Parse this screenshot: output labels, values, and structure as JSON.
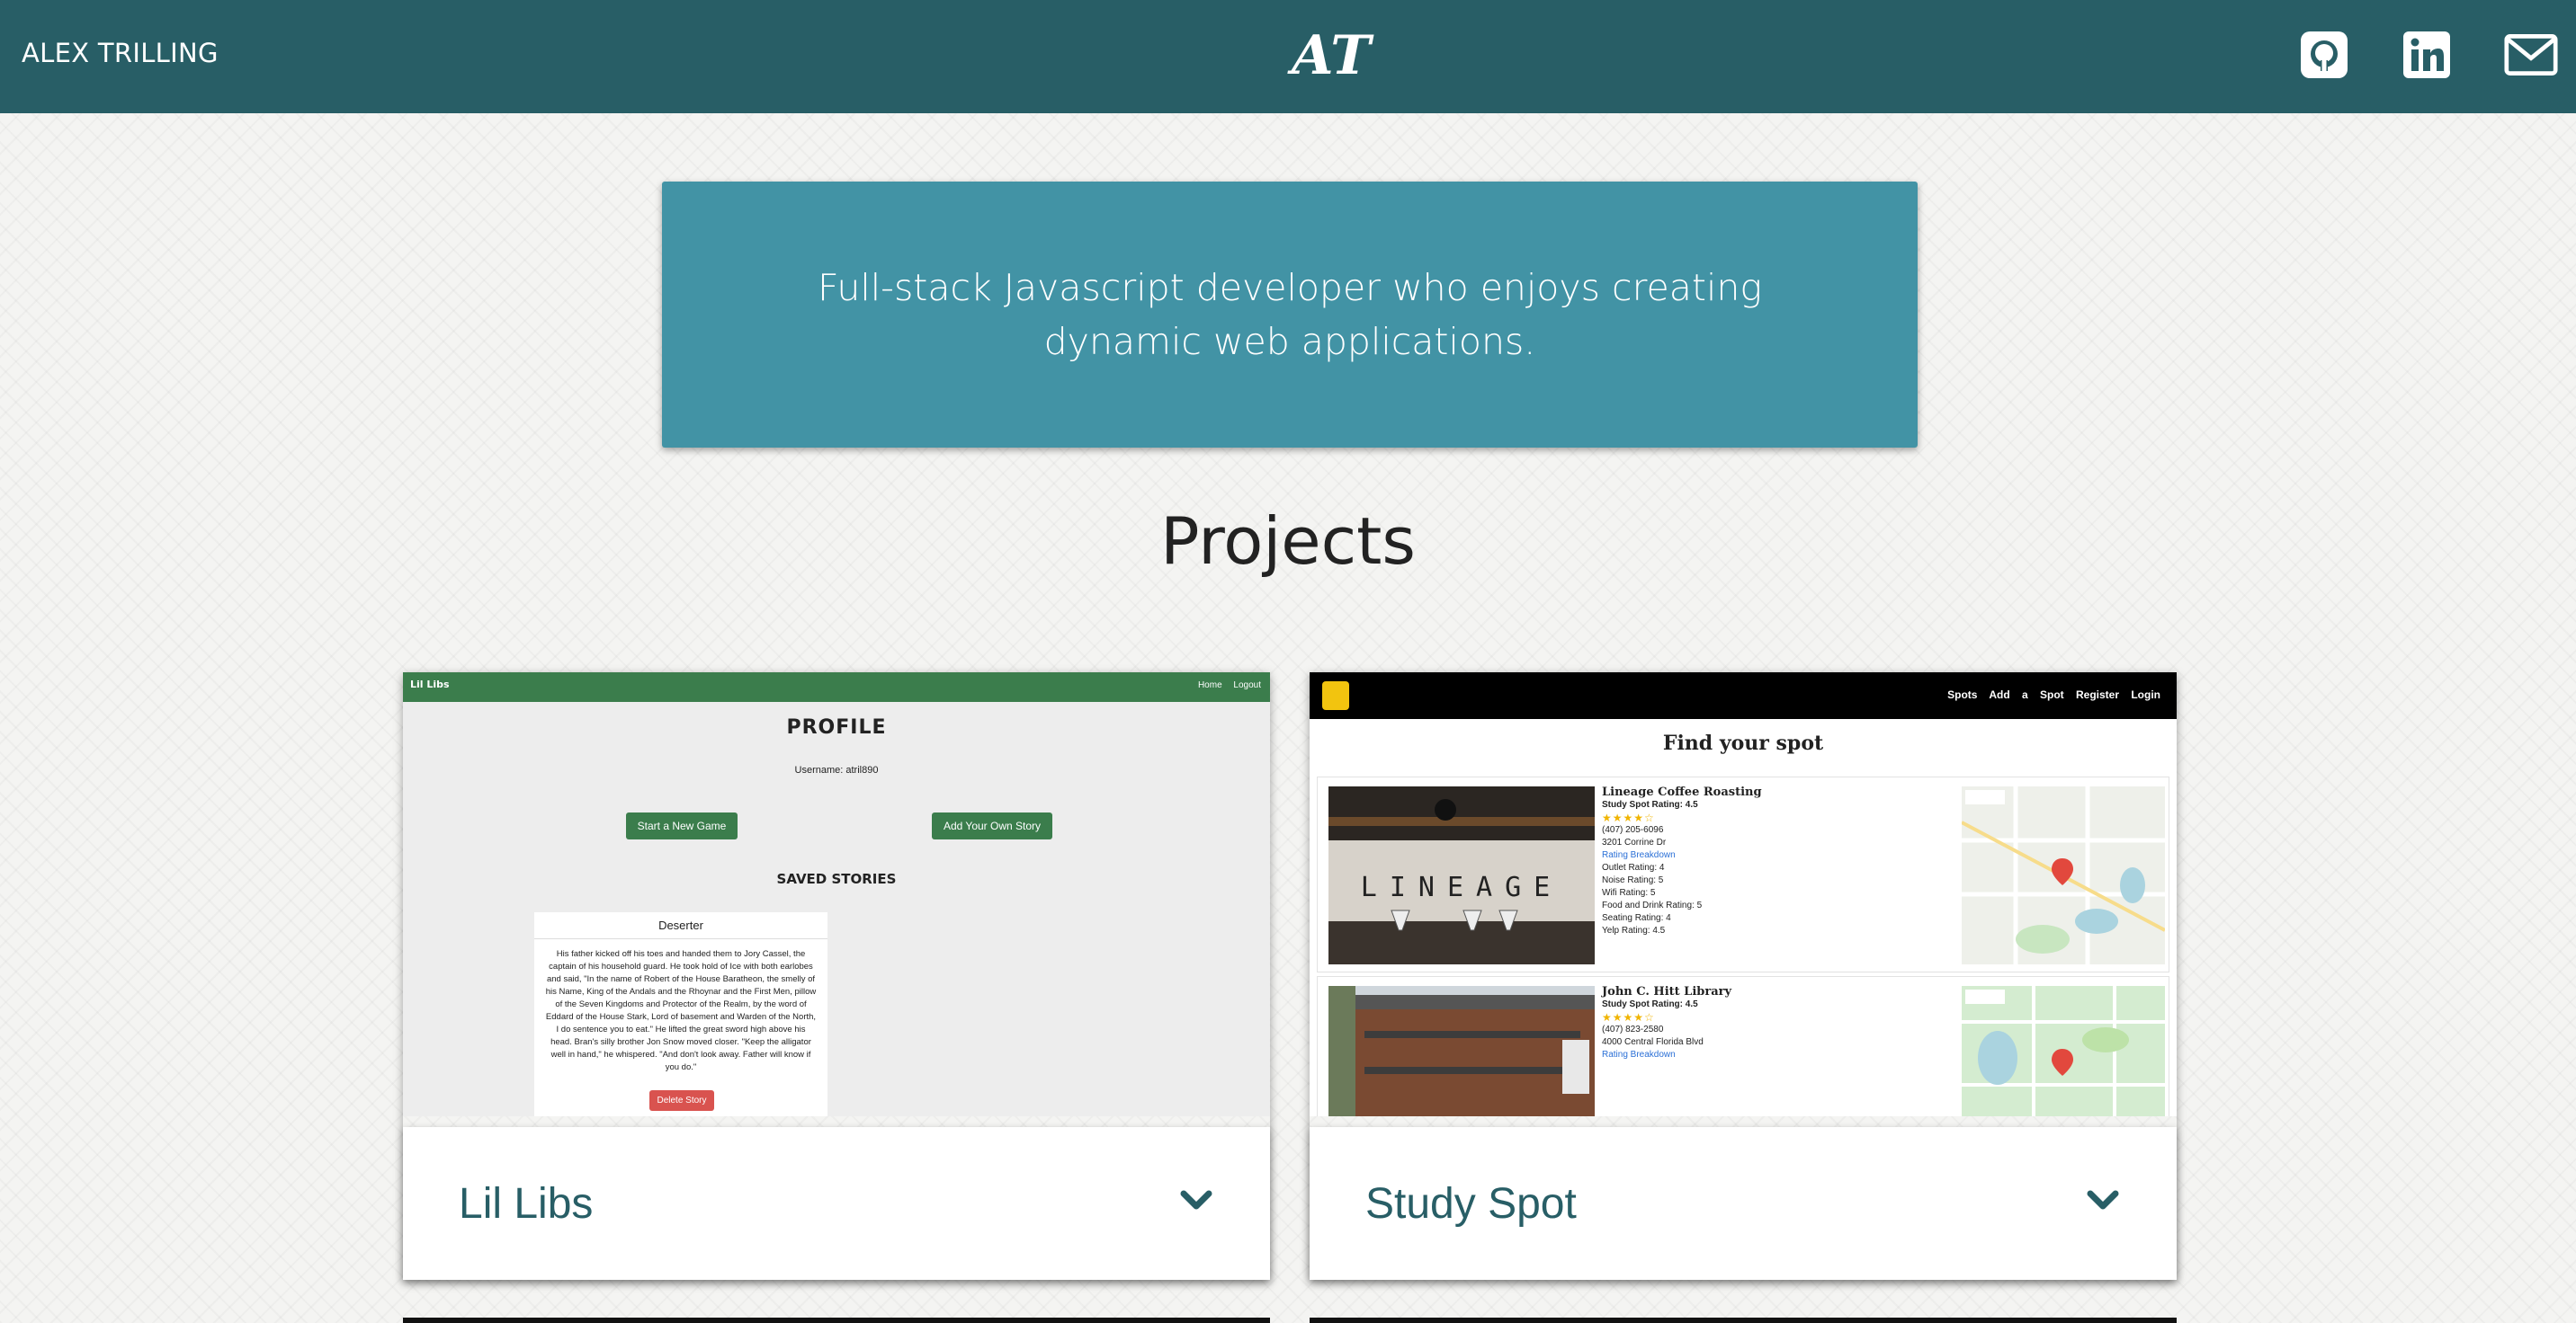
{
  "header": {
    "brand": "ALEX TRILLING",
    "logo": "AT",
    "social": [
      {
        "icon": "github-icon"
      },
      {
        "icon": "linkedin-icon"
      },
      {
        "icon": "mail-icon"
      }
    ]
  },
  "hero": {
    "text": "Full-stack Javascript developer who enjoys creating dynamic web applications."
  },
  "projects": {
    "title": "Projects",
    "items": [
      {
        "name": "Lil Libs",
        "screenshot": {
          "brand": "Lil Libs",
          "nav": "Home Logout",
          "heading": "PROFILE",
          "username": "Username: atril890",
          "btn_new": "Start a New Game",
          "btn_add": "Add Your Own Story",
          "saved": "SAVED STORIES",
          "story_title": "Deserter",
          "story_text": "His father kicked off his toes and handed them to Jory Cassel, the captain of his household guard. He took hold of Ice with both earlobes and said, \"In the name of Robert of the House Baratheon, the smelly of his Name, King of the Andals and the Rhoynar and the First Men, pillow of the Seven Kingdoms and Protector of the Realm, by the word of Eddard of the House Stark, Lord of basement and Warden of the North, I do sentence you to eat.\" He lifted the great sword high above his head. Bran's silly brother Jon Snow moved closer. \"Keep the alligator well in hand,\" he whispered. \"And don't look away. Father will know if you do.\"",
          "delete": "Delete Story"
        }
      },
      {
        "name": "Study Spot",
        "screenshot": {
          "nav": "Spots Add a Spot Register Login",
          "heading": "Find your spot",
          "spots": [
            {
              "name": "Lineage Coffee Roasting",
              "rating": "Study Spot Rating: 4.5",
              "stars": "★★★★☆",
              "phone": "(407) 205-6096",
              "address": "3201 Corrine Dr",
              "breakdown": "Rating Breakdown",
              "details": [
                "Outlet Rating: 4",
                "Noise Rating: 5",
                "Wifi Rating: 5",
                "Food and Drink Rating: 5",
                "Seating Rating: 4",
                "Yelp Rating: 4.5"
              ],
              "sign": "LINEAGE"
            },
            {
              "name": "John C. Hitt Library",
              "rating": "Study Spot Rating: 4.5",
              "stars": "★★★★☆",
              "phone": "(407) 823-2580",
              "address": "4000 Central Florida Blvd",
              "breakdown": "Rating Breakdown",
              "details": []
            }
          ]
        }
      }
    ]
  },
  "colors": {
    "nav": "#285e66",
    "hero": "#4293a5",
    "project_title": "#285e66"
  }
}
